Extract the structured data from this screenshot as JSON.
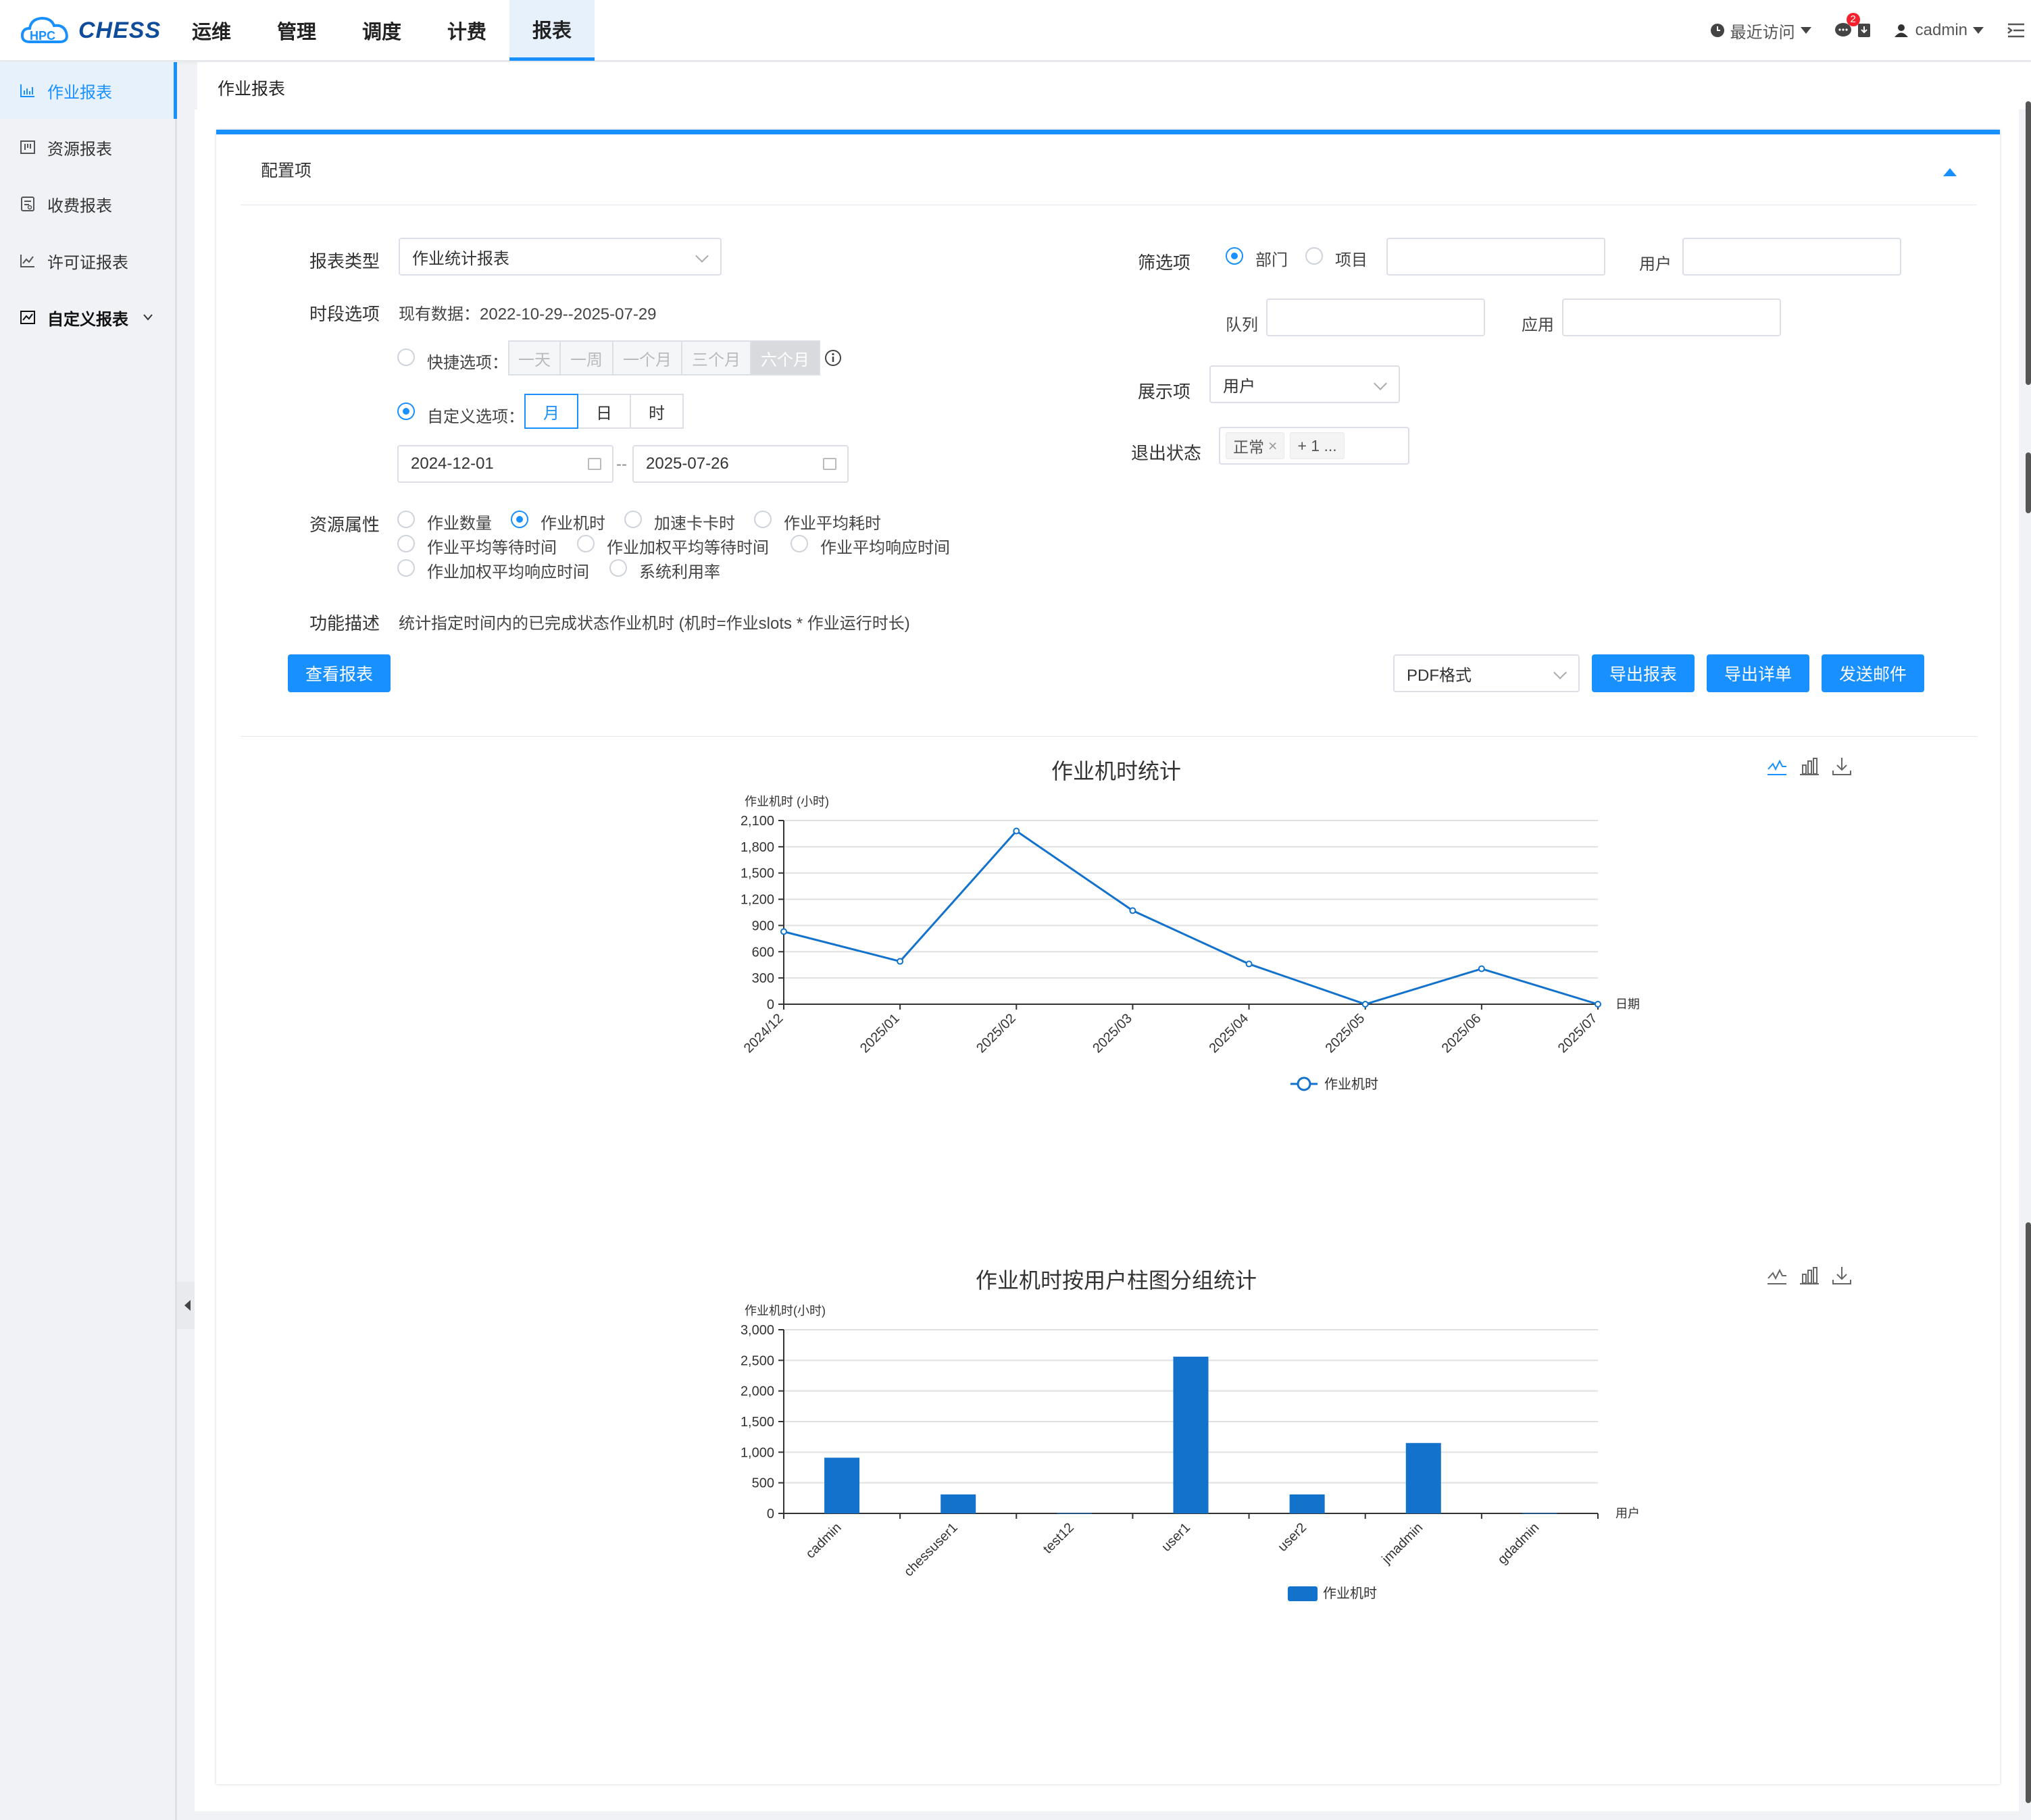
{
  "app": {
    "logo_text": "CHESS"
  },
  "nav": {
    "items": [
      "运维",
      "管理",
      "调度",
      "计费",
      "报表"
    ]
  },
  "top_right": {
    "recent": "最近访问",
    "badge": "2",
    "user": "cadmin"
  },
  "sidebar": {
    "items": [
      "作业报表",
      "资源报表",
      "收费报表",
      "许可证报表",
      "自定义报表"
    ]
  },
  "breadcrumb": "作业报表",
  "config": {
    "title": "配置项",
    "report_type_label": "报表类型",
    "report_type_value": "作业统计报表",
    "period_label": "时段选项",
    "existing_data": "现有数据：2022-10-29--2025-07-29",
    "quick_label": "快捷选项：",
    "quick_options": [
      "一天",
      "一周",
      "一个月",
      "三个月",
      "六个月"
    ],
    "custom_label": "自定义选项：",
    "custom_options": [
      "月",
      "日",
      "时"
    ],
    "start_date": "2024-12-01",
    "date_sep": "--",
    "end_date": "2025-07-26",
    "resource_label": "资源属性",
    "resource_options": [
      "作业数量",
      "作业机时",
      "加速卡卡时",
      "作业平均耗时",
      "作业平均等待时间",
      "作业加权平均等待时间",
      "作业平均响应时间",
      "作业加权平均响应时间",
      "系统利用率"
    ],
    "desc_label": "功能描述",
    "desc_text": "统计指定时间内的已完成状态作业机时 (机时=作业slots * 作业运行时长)",
    "filter_label": "筛选项",
    "filter_dept": "部门",
    "filter_project": "项目",
    "user_label": "用户",
    "queue_label": "队列",
    "app_label": "应用",
    "display_label": "展示项",
    "display_value": "用户",
    "exit_label": "退出状态",
    "exit_tag": "正常",
    "exit_more": "+ 1 ...",
    "view_button": "查看报表",
    "format_value": "PDF格式",
    "export_button": "导出报表",
    "export_detail_button": "导出详单",
    "send_mail_button": "发送邮件"
  },
  "chart_data": [
    {
      "type": "line",
      "title": "作业机时统计",
      "ylabel": "作业机时 (小时)",
      "xlabel": "日期",
      "x": [
        "2024/12",
        "2025/01",
        "2025/02",
        "2025/03",
        "2025/04",
        "2025/05",
        "2025/06",
        "2025/07"
      ],
      "series": [
        {
          "name": "作业机时",
          "values": [
            830,
            490,
            1980,
            1070,
            460,
            0,
            405,
            0
          ]
        }
      ],
      "ylim": [
        0,
        2100
      ],
      "yticks": [
        "0",
        "300",
        "600",
        "900",
        "1,200",
        "1,500",
        "1,800",
        "2,100"
      ],
      "grid": true,
      "legend": "bottom"
    },
    {
      "type": "bar",
      "title": "作业机时按用户柱图分组统计",
      "ylabel": "作业机时(小时)",
      "xlabel": "用户",
      "categories": [
        "cadmin",
        "chessuser1",
        "test12",
        "user1",
        "user2",
        "jmadmin",
        "gdadmin"
      ],
      "series": [
        {
          "name": "作业机时",
          "values": [
            910,
            310,
            5,
            2560,
            310,
            1150,
            5
          ]
        }
      ],
      "ylim": [
        0,
        3000
      ],
      "yticks": [
        "0",
        "500",
        "1,000",
        "1,500",
        "2,000",
        "2,500",
        "3,000"
      ],
      "grid": true,
      "legend": "bottom"
    }
  ],
  "colors": {
    "accent": "#1890ff",
    "series": "#1372cc"
  }
}
